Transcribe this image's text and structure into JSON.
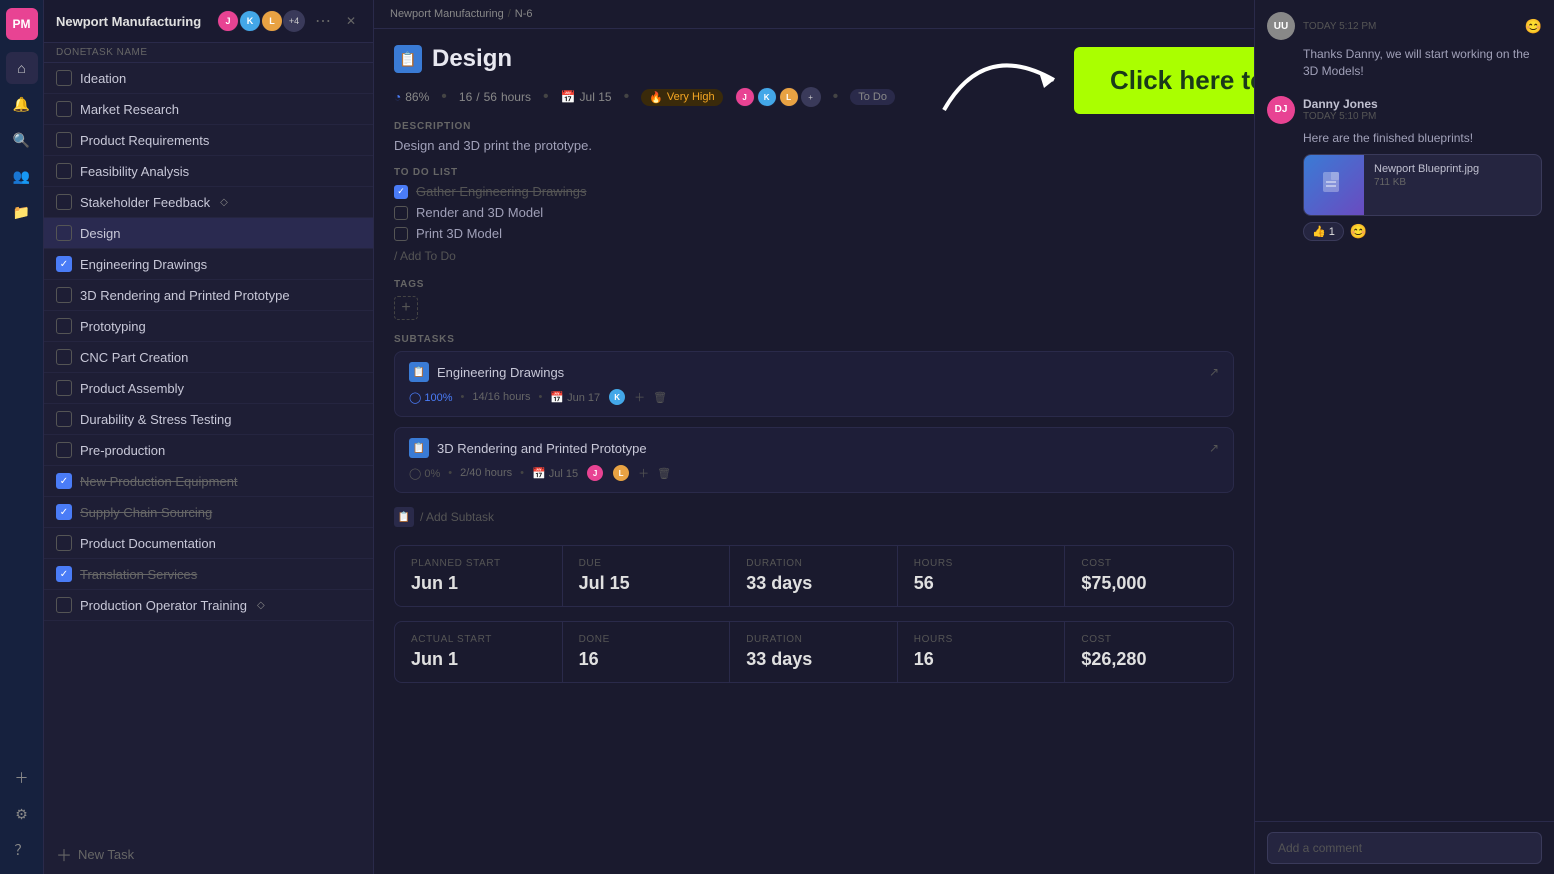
{
  "app": {
    "logo": "PM"
  },
  "project": {
    "title": "Newport Manufacturing",
    "breadcrumb_project": "Newport Manufacturing",
    "breadcrumb_sep": "/",
    "breadcrumb_id": "N-6"
  },
  "task_list": {
    "done_col": "DONE",
    "name_col": "TASK NAME",
    "items": [
      {
        "id": 1,
        "name": "Ideation",
        "checked": false,
        "strikethrough": false,
        "diamond": false
      },
      {
        "id": 2,
        "name": "Market Research",
        "checked": false,
        "strikethrough": false,
        "diamond": false
      },
      {
        "id": 3,
        "name": "Product Requirements",
        "checked": false,
        "strikethrough": false,
        "diamond": false
      },
      {
        "id": 4,
        "name": "Feasibility Analysis",
        "checked": false,
        "strikethrough": false,
        "diamond": false
      },
      {
        "id": 5,
        "name": "Stakeholder Feedback",
        "checked": false,
        "strikethrough": false,
        "diamond": true
      },
      {
        "id": 6,
        "name": "Design",
        "checked": false,
        "strikethrough": false,
        "diamond": false,
        "active": true
      },
      {
        "id": 7,
        "name": "Engineering Drawings",
        "checked": true,
        "strikethrough": false,
        "diamond": false
      },
      {
        "id": 8,
        "name": "3D Rendering and Printed Prototype",
        "checked": false,
        "strikethrough": false,
        "diamond": false
      },
      {
        "id": 9,
        "name": "Prototyping",
        "checked": false,
        "strikethrough": false,
        "diamond": false
      },
      {
        "id": 10,
        "name": "CNC Part Creation",
        "checked": false,
        "strikethrough": false,
        "diamond": false
      },
      {
        "id": 11,
        "name": "Product Assembly",
        "checked": false,
        "strikethrough": false,
        "diamond": false
      },
      {
        "id": 12,
        "name": "Durability & Stress Testing",
        "checked": false,
        "strikethrough": false,
        "diamond": false
      },
      {
        "id": 13,
        "name": "Pre-production",
        "checked": false,
        "strikethrough": false,
        "diamond": false
      },
      {
        "id": 14,
        "name": "New Production Equipment",
        "checked": true,
        "strikethrough": true,
        "diamond": false
      },
      {
        "id": 15,
        "name": "Supply Chain Sourcing",
        "checked": true,
        "strikethrough": true,
        "diamond": false
      },
      {
        "id": 16,
        "name": "Product Documentation",
        "checked": false,
        "strikethrough": false,
        "diamond": false
      },
      {
        "id": 17,
        "name": "Translation Services",
        "checked": true,
        "strikethrough": true,
        "diamond": false
      },
      {
        "id": 18,
        "name": "Production Operator Training",
        "checked": false,
        "strikethrough": false,
        "diamond": true
      }
    ],
    "add_task_label": "New Task"
  },
  "task_detail": {
    "title": "Design",
    "progress_pct": "86%",
    "hours_done": "16",
    "hours_total": "56",
    "due_date": "Jul 15",
    "priority": "Very High",
    "status": "To Do",
    "description_label": "DESCRIPTION",
    "description_text": "Design and 3D print the prototype.",
    "todo_label": "TO DO LIST",
    "todo_items": [
      {
        "text": "Gather Engineering Drawings",
        "done": true
      },
      {
        "text": "Render and 3D Model",
        "done": false
      },
      {
        "text": "Print 3D Model",
        "done": false
      }
    ],
    "add_todo_label": "/ Add To Do",
    "tags_label": "TAGS",
    "subtasks_label": "SUBTASKS",
    "subtasks": [
      {
        "name": "Engineering Drawings",
        "progress": "100%",
        "hours_done": "14",
        "hours_total": "16",
        "due_date": "Jun 17"
      },
      {
        "name": "3D Rendering and Printed Prototype",
        "progress": "0%",
        "hours_done": "2",
        "hours_total": "40",
        "due_date": "Jul 15"
      }
    ],
    "add_subtask_label": "/ Add Subtask",
    "planned_start_label": "PLANNED START",
    "planned_start_value": "Jun 1",
    "due_label": "DUE",
    "due_value": "Jul 15",
    "duration_label": "DURATION",
    "duration_value": "33 days",
    "hours_label": "HOURS",
    "hours_value": "56",
    "cost_label": "COST",
    "cost_value": "$75,000",
    "actual_start_label": "ACTUAL START",
    "actual_start_value": "Jun 1",
    "done_label": "DONE",
    "done_value": "16",
    "actual_duration_label": "DURATION",
    "actual_duration_value": "33 days",
    "actual_hours_label": "HOURS",
    "actual_hours_value": "16",
    "actual_cost_label": "COST",
    "actual_cost_value": "$26,280"
  },
  "comments": {
    "items": [
      {
        "author": "Unknown User",
        "initials": "UU",
        "avatar_color": "#888",
        "time": "TODAY 5:12 PM",
        "text": "Thanks Danny, we will start working on the 3D Models!"
      },
      {
        "author": "Danny Jones",
        "initials": "DJ",
        "avatar_color": "#e84393",
        "time": "TODAY 5:10 PM",
        "text": "Here are the finished blueprints!",
        "attachment": {
          "name": "Newport Blueprint.jpg",
          "size": "711 KB"
        },
        "reaction_emoji": "👍",
        "reaction_count": "1"
      }
    ],
    "add_comment_placeholder": "Add a comment"
  },
  "cta": {
    "label": "Click here to start your free trial"
  },
  "icons": {
    "home": "⌂",
    "notifications": "🔔",
    "search": "🔍",
    "people": "👥",
    "folder": "📁",
    "add": "+",
    "settings": "⚙",
    "help": "?",
    "more": "⋯",
    "close": "✕",
    "external": "↗",
    "check": "✓"
  }
}
